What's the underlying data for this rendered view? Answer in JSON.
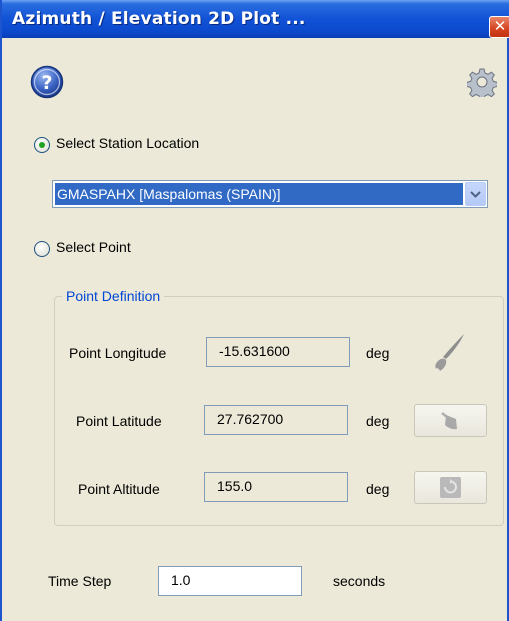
{
  "window": {
    "title": "Azimuth / Elevation 2D Plot ...",
    "close_glyph": "✕"
  },
  "toolbar": {
    "help_icon": "help-icon",
    "settings_icon": "gear-icon"
  },
  "station": {
    "radio_label": "Select Station Location",
    "selected": true,
    "dropdown_value": "GMASPAHX [Maspalomas (SPAIN)]"
  },
  "point": {
    "radio_label": "Select Point",
    "selected": false,
    "group_title": "Point Definition",
    "fields": [
      {
        "label": "Point Longitude",
        "value": "-15.631600",
        "unit": "deg",
        "tool_icon": "brush-icon"
      },
      {
        "label": "Point Latitude",
        "value": "27.762700",
        "unit": "deg",
        "tool_icon": "broom-icon"
      },
      {
        "label": "Point Altitude",
        "value": "155.0",
        "unit": "deg",
        "tool_icon": "reset-icon"
      }
    ]
  },
  "time_step": {
    "label": "Time Step",
    "value": "1.0",
    "unit": "seconds"
  },
  "colors": {
    "titlebar": "#0b48cc",
    "selection": "#316ac5",
    "group_title": "#0046d5",
    "background": "#ece9d8"
  }
}
